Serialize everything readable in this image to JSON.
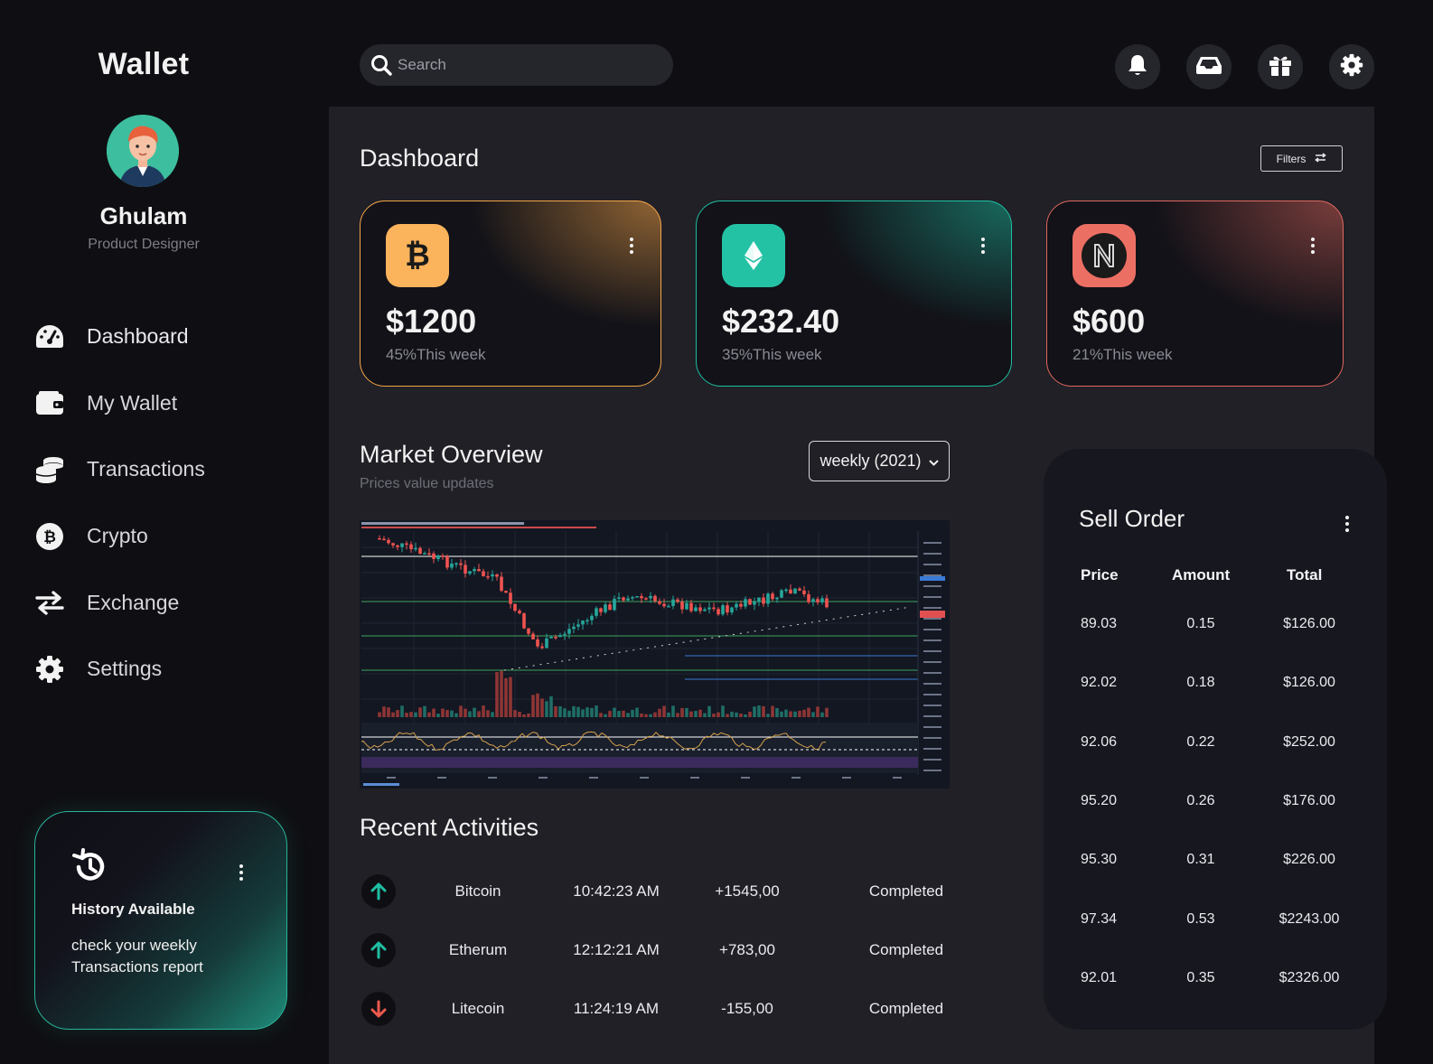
{
  "sidebar": {
    "brand": "Wallet",
    "user": {
      "name": "Ghulam",
      "role": "Product Designer"
    },
    "nav": [
      {
        "label": "Dashboard",
        "icon": "speedometer-icon"
      },
      {
        "label": "My Wallet",
        "icon": "wallet-icon"
      },
      {
        "label": "Transactions",
        "icon": "coins-stack-icon"
      },
      {
        "label": "Crypto",
        "icon": "bitcoin-icon"
      },
      {
        "label": "Exchange",
        "icon": "exchange-arrows-icon"
      },
      {
        "label": "Settings",
        "icon": "gear-icon"
      }
    ],
    "history": {
      "title": "History Available",
      "description": "check your weekly Transactions report"
    }
  },
  "topbar": {
    "search_placeholder": "Search",
    "icons": [
      "bell-icon",
      "inbox-icon",
      "gift-icon",
      "gear-icon"
    ]
  },
  "main": {
    "title": "Dashboard",
    "filters_label": "Filters",
    "cards": [
      {
        "coin": "bitcoin",
        "value": "$1200",
        "change": "45%This week",
        "accent": "#f6a64a",
        "icon_bg": "#fbb35c"
      },
      {
        "coin": "ethereum",
        "value": "$232.40",
        "change": "35%This week",
        "accent": "#1fbfa3",
        "icon_bg": "#24c2a5"
      },
      {
        "coin": "near",
        "value": "$600",
        "change": "21%This week",
        "accent": "#e0685f",
        "icon_bg": "#ec6f64"
      }
    ],
    "market": {
      "title": "Market Overview",
      "subtitle": "Prices value updates",
      "period": "weekly (2021)"
    },
    "recent": {
      "title": "Recent Activities",
      "rows": [
        {
          "direction": "up",
          "coin": "Bitcoin",
          "time": "10:42:23 AM",
          "amount": "+1545,00",
          "status": "Completed"
        },
        {
          "direction": "up",
          "coin": "Etherum",
          "time": "12:12:21 AM",
          "amount": "+783,00",
          "status": "Completed"
        },
        {
          "direction": "down",
          "coin": "Litecoin",
          "time": "11:24:19 AM",
          "amount": "-155,00",
          "status": "Completed"
        }
      ]
    }
  },
  "sell_order": {
    "title": "Sell Order",
    "headers": [
      "Price",
      "Amount",
      "Total"
    ],
    "rows": [
      {
        "price": "89.03",
        "amount": "0.15",
        "total": "$126.00"
      },
      {
        "price": "92.02",
        "amount": "0.18",
        "total": "$126.00"
      },
      {
        "price": "92.06",
        "amount": "0.22",
        "total": "$252.00"
      },
      {
        "price": "95.20",
        "amount": "0.26",
        "total": "$176.00"
      },
      {
        "price": "95.30",
        "amount": "0.31",
        "total": "$226.00"
      },
      {
        "price": "97.34",
        "amount": "0.53",
        "total": "$2243.00"
      },
      {
        "price": "92.01",
        "amount": "0.35",
        "total": "$2326.00"
      }
    ]
  },
  "colors": {
    "up": "#1fbfa3",
    "down": "#ef5a4f",
    "panel": "#202026",
    "background": "#0f0f13"
  }
}
